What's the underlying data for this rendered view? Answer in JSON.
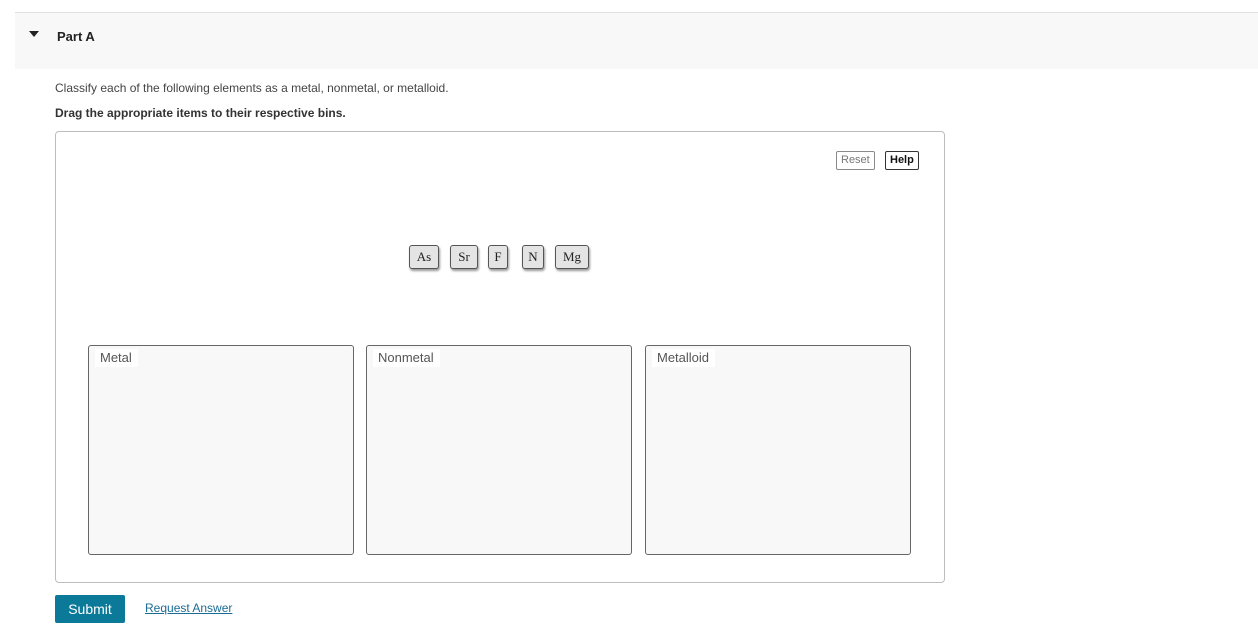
{
  "part": {
    "title": "Part A",
    "caret_icon": "caret-down-icon"
  },
  "instructions": {
    "text": "Classify each of the following elements as a metal, nonmetal, or metalloid.",
    "drag_text": "Drag the appropriate items to their respective bins."
  },
  "toolbar": {
    "reset_label": "Reset",
    "help_label": "Help"
  },
  "tokens": [
    "As",
    "Sr",
    "F",
    "N",
    "Mg"
  ],
  "bins": [
    "Metal",
    "Nonmetal",
    "Metalloid"
  ],
  "actions": {
    "submit_label": "Submit",
    "request_answer_label": "Request Answer"
  },
  "colors": {
    "submit_bg": "#0b7a99",
    "link": "#1a6c96"
  }
}
